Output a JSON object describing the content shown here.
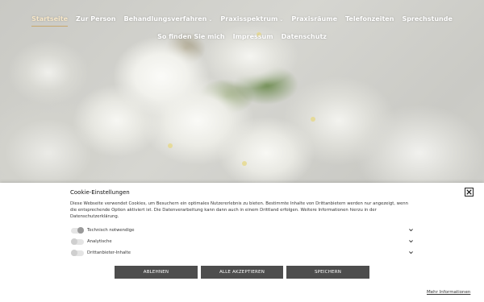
{
  "nav": {
    "row1": [
      {
        "label": "Startseite",
        "active": true
      },
      {
        "label": "Zur Person"
      },
      {
        "label": "Behandlungsverfahren",
        "has_submenu": true
      },
      {
        "label": "Praxisspektrum",
        "has_submenu": true
      },
      {
        "label": "Praxisräume"
      },
      {
        "label": "Telefonzeiten"
      },
      {
        "label": "Sprechstunde"
      }
    ],
    "row2": [
      {
        "label": "So finden Sie mich"
      },
      {
        "label": "Impressum"
      },
      {
        "label": "Datenschutz"
      }
    ]
  },
  "cookie": {
    "title": "Cookie-Einstellungen",
    "text": "Diese Webseite verwendet Cookies, um Besuchern ein optimales Nutzererlebnis zu bieten. Bestimmte Inhalte von Drittanbietern werden nur angezeigt, wenn die entsprechende Option aktiviert ist. Die Datenverarbeitung kann dann auch in einem Drittland erfolgen. Weitere Informationen hierzu in der Datenschutzerklärung.",
    "options": [
      {
        "label": "Technisch notwendige",
        "enabled": true
      },
      {
        "label": "Analytische",
        "enabled": false
      },
      {
        "label": "Drittanbieter-Inhalte",
        "enabled": false
      }
    ],
    "buttons": {
      "reject": "ABLEHNEN",
      "accept_all": "ALLE AKZEPTIEREN",
      "save": "SPEICHERN"
    },
    "more_info": "Mehr Informationen"
  },
  "colors": {
    "nav_text": "#ffffff",
    "nav_active_underline": "#c8a76b",
    "button_bg": "#4d4d4d",
    "banner_bg": "#ffffff"
  }
}
